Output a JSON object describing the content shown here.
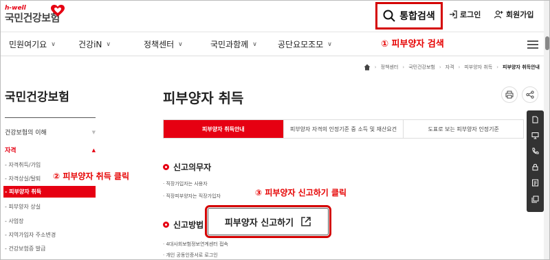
{
  "header": {
    "logo_sub": "h-well",
    "logo_main": "국민건강보험",
    "search_label": "통합검색",
    "login_label": "로그인",
    "signup_label": "회원가입"
  },
  "gnb": {
    "items": [
      "민원여기요",
      "건강iN",
      "정책센터",
      "국민과함께",
      "공단요모조모"
    ]
  },
  "annotations": {
    "a1": "① 피부양자 검색",
    "a2": "② 피부양자 취득 클릭",
    "a3": "③ 피부양자 신고하기 클릭"
  },
  "breadcrumb": [
    "정책센터",
    "국민건강보험",
    "자격",
    "피부양자 취득",
    "피부양자 취득안내"
  ],
  "sidebar": {
    "title": "국민건강보험",
    "section1": "건강보험의 이해",
    "section2": "자격",
    "items": [
      "자격취득/가입",
      "자격상실/탈퇴",
      "피부양자 취득",
      "피부양자 상실",
      "사업장",
      "지역가입자 주소변경",
      "건강보험증 발급"
    ]
  },
  "main": {
    "title": "피부양자 취득",
    "tabs": [
      "피부양자 취득안내",
      "피부양자 자격의 인정기준 중 소득 및 재산요건",
      "도표로 보는 피부양자 인정기준"
    ],
    "section1_title": "신고의무자",
    "section1_bullets": [
      "직장가입자는 사용자",
      "직장피부양자는 직장가입자"
    ],
    "section2_title": "신고방법",
    "section2_bullets": [
      "4대사회보험정보연계센터 접속",
      "개인 공동인증서로 로그인"
    ],
    "report_button": "피부양자 신고하기"
  },
  "colors": {
    "brand": "#e60012",
    "highlight": "#d40000"
  }
}
